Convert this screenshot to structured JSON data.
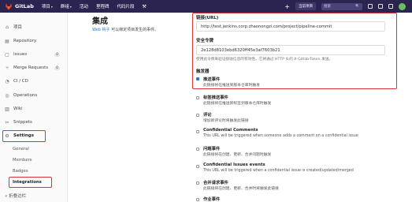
{
  "topbar": {
    "brand": "GitLab",
    "nav": [
      {
        "label": "项目",
        "caret": "▾"
      },
      {
        "label": "群组",
        "caret": "▾"
      },
      {
        "label": "活动",
        "caret": ""
      },
      {
        "label": "里程碑",
        "caret": ""
      },
      {
        "label": "代码片段",
        "caret": ""
      }
    ],
    "plus": "+",
    "context": "当前项目",
    "search_placeholder": "搜索",
    "search_icon": "🔍"
  },
  "sidebar": {
    "items": [
      {
        "label": "项目",
        "icon": "⌂",
        "count": ""
      },
      {
        "label": "Repository",
        "icon": "▤",
        "count": ""
      },
      {
        "label": "Issues",
        "icon": "▢",
        "count": "0"
      },
      {
        "label": "Merge Requests",
        "icon": "⑂",
        "count": "0"
      },
      {
        "label": "CI / CD",
        "icon": "◔",
        "count": ""
      },
      {
        "label": "Operations",
        "icon": "◎",
        "count": ""
      },
      {
        "label": "Wiki",
        "icon": "▥",
        "count": ""
      },
      {
        "label": "Snippets",
        "icon": "✂",
        "count": ""
      }
    ],
    "settings": {
      "label": "Settings",
      "icon": "⚙"
    },
    "sub_items": [
      "General",
      "Members",
      "Badges",
      "Integrations"
    ],
    "collapse": "« 折叠边栏"
  },
  "main": {
    "title": "集成",
    "desc_link": "Web 钩子",
    "desc_text": " 可以绑定项目发生的事件。"
  },
  "form": {
    "url_label": "链接(URL)",
    "url_value": "http://test.jenkins.corp.zhaonongzi.com/project/pipeline-commit",
    "token_label": "安全令牌",
    "token_value": "2e128d8103ebd6320ff45e3af7603b21",
    "token_help": "使用此令牌来验证接收信息的有效性。它将通过 HTTP 头的 X-Gitlab-Token 发送。",
    "trigger_label": "触发器",
    "events": [
      {
        "title": "推送事件",
        "desc": "此链接将在推送到版本仓库时触发",
        "checked": true
      },
      {
        "title": "标签推送事件",
        "desc": "此链接将在推送新标签到版本仓库时触发",
        "checked": false
      },
      {
        "title": "评论",
        "desc": "增加新评论时将触发此链接",
        "checked": false
      },
      {
        "title": "Confidential Comments",
        "desc": "This URL will be triggered when someone adds a comment on a confidential issue",
        "checked": false
      },
      {
        "title": "问题事件",
        "desc": "此链接将在创建、更新、合并问题时触发",
        "checked": false
      },
      {
        "title": "Confidential Issues events",
        "desc": "This URL will be triggered when a confidential issue is created/updated/merged",
        "checked": false
      },
      {
        "title": "合并请求事件",
        "desc": "此链接将在创建、更新、合并时将触发此链接",
        "checked": false
      },
      {
        "title": "作业事件",
        "desc": "",
        "checked": false
      }
    ]
  },
  "colors": {
    "nav_bg": "#2b2450",
    "highlight": "#e03232",
    "link": "#1f78d1"
  }
}
